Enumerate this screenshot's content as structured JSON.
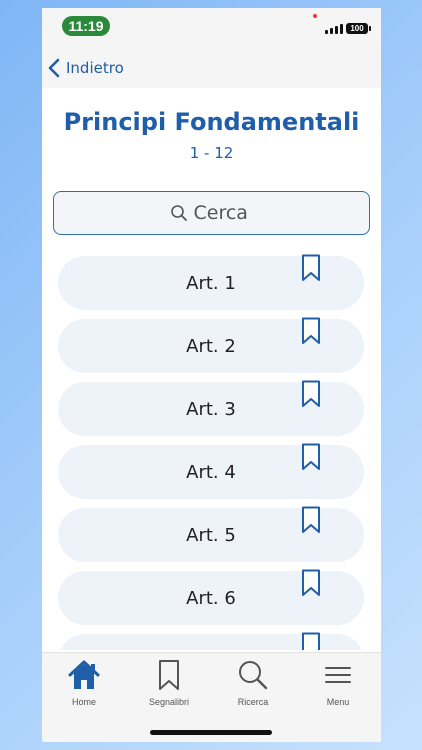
{
  "status": {
    "time": "11:19",
    "battery": "100"
  },
  "nav": {
    "back_label": "Indietro"
  },
  "header": {
    "title": "Principi Fondamentali",
    "range": "1 - 12"
  },
  "search": {
    "placeholder": "Cerca"
  },
  "articles": [
    {
      "label": "Art. 1"
    },
    {
      "label": "Art. 2"
    },
    {
      "label": "Art. 3"
    },
    {
      "label": "Art. 4"
    },
    {
      "label": "Art. 5"
    },
    {
      "label": "Art. 6"
    },
    {
      "label": ""
    }
  ],
  "tabs": [
    {
      "label": "Home",
      "icon": "home-icon",
      "active": true
    },
    {
      "label": "Segnalibri",
      "icon": "bookmark-icon"
    },
    {
      "label": "Ricerca",
      "icon": "search-icon"
    },
    {
      "label": "Menu",
      "icon": "menu-icon"
    }
  ],
  "colors": {
    "accent": "#1f5ea8",
    "item_bg": "#eef3f9",
    "status_green": "#2a8a3a"
  }
}
